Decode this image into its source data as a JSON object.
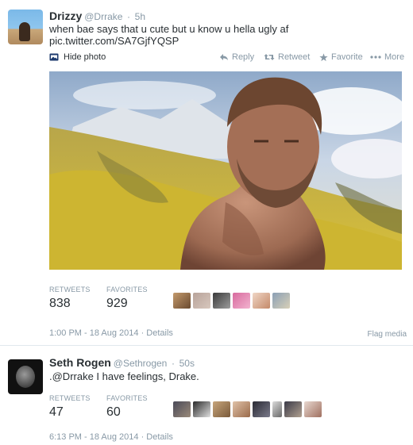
{
  "tweets": [
    {
      "name": "Drizzy",
      "handle": "@Drrake",
      "separator": "·",
      "time": "5h",
      "text": "when bae says that u cute but u know u hella ugly af",
      "link": "pic.twitter.com/SA7GjfYQSP",
      "hide_photo": "Hide photo",
      "actions": {
        "reply": "Reply",
        "retweet": "Retweet",
        "favorite": "Favorite",
        "more": "More"
      },
      "retweets_label": "RETWEETS",
      "retweets": "838",
      "favorites_label": "FAVORITES",
      "favorites": "929",
      "timestamp": "1:00 PM - 18 Aug 2014 · Details",
      "flag": "Flag media"
    },
    {
      "name": "Seth Rogen",
      "handle": "@Sethrogen",
      "separator": "·",
      "time": "50s",
      "text": ".@Drrake I have feelings, Drake.",
      "retweets_label": "RETWEETS",
      "retweets": "47",
      "favorites_label": "FAVORITES",
      "favorites": "60",
      "timestamp": "6:13 PM - 18 Aug 2014 · Details"
    }
  ],
  "colors": {
    "link": "#292f33",
    "muted": "#8899a6",
    "text": "#292f33",
    "border": "#e1e8ed"
  },
  "icons": [
    "hide-photo-icon",
    "reply-icon",
    "retweet-icon",
    "favorite-star-icon",
    "more-dots-icon"
  ]
}
